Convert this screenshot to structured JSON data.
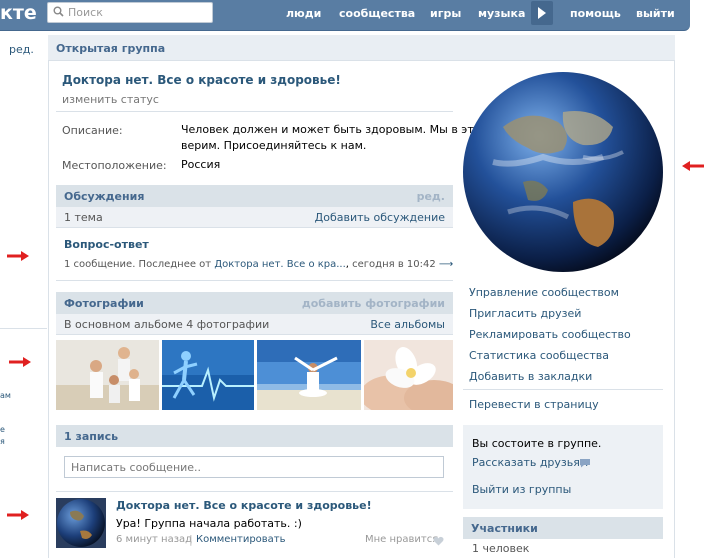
{
  "header": {
    "logo": "кте",
    "search_placeholder": "Поиск",
    "nav": [
      "люди",
      "сообщества",
      "игры",
      "музыка",
      "помощь",
      "выйти"
    ]
  },
  "left": {
    "edit_label": "ред.",
    "fragments": [
      "ам",
      "е",
      "я"
    ]
  },
  "group": {
    "type_title": "Открытая группа",
    "name": "Доктора нет. Все о красоте и здоровье!",
    "change_status": "изменить статус",
    "description_label": "Описание:",
    "description_line1": "Человек должен и может быть здоровым. Мы в это",
    "description_line2": "верим. Присоединяйтесь к нам.",
    "location_label": "Местоположение:",
    "location_value": "Россия"
  },
  "discussions": {
    "title": "Обсуждения",
    "edit": "ред.",
    "count": "1 тема",
    "add": "Добавить обсуждение",
    "topic_title": "Вопрос-ответ",
    "topic_meta_prefix": "1 сообщение. Последнее от",
    "topic_author": "Доктора нет. Все о кра...",
    "topic_time": "сегодня в 10:42",
    "topic_arrow": "⟶"
  },
  "photos": {
    "title": "Фотографии",
    "add": "добавить фотографии",
    "album_info": "В основном альбоме 4 фотографии",
    "all_albums": "Все альбомы"
  },
  "wall": {
    "title": "1 запись",
    "input_placeholder": "Написать сообщение..",
    "post_author": "Доктора нет. Все о красоте и здоровье!",
    "post_text": "Ура! Группа начала работать. :)",
    "post_time": "6 минут назад",
    "comment": "Комментировать",
    "like": "Мне нравится"
  },
  "sidebar": {
    "links": [
      "Управление сообществом",
      "Пригласить друзей",
      "Рекламировать сообщество",
      "Статистика сообщества",
      "Добавить в закладки"
    ],
    "convert": "Перевести в страницу",
    "member_status": "Вы состоите в группе.",
    "tell_friends": "Рассказать друзьям",
    "leave": "Выйти из группы",
    "members_title": "Участники",
    "members_count": "1 человек"
  },
  "colors": {
    "brand": "#597da3",
    "link": "#2b587a",
    "section_head": "#dae2e8",
    "arrow": "#e02020"
  }
}
